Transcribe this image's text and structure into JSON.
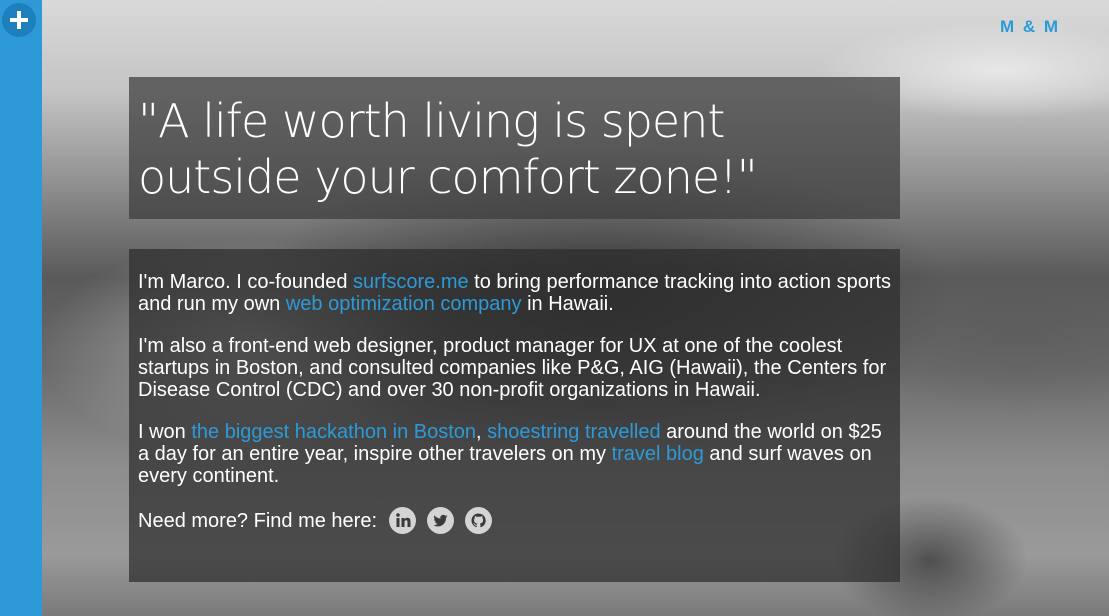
{
  "brand": {
    "label": "M & M"
  },
  "sidebar": {
    "toggle_icon": "plus-icon"
  },
  "hero": {
    "quote": "\"A life worth living is spent outside your comfort zone!\""
  },
  "bio": {
    "p1": {
      "t1": "I'm Marco. I co-founded ",
      "link1": "surfscore.me",
      "t2": " to bring performance tracking into action sports and run my own ",
      "link2": "web optimization company",
      "t3": " in Hawaii."
    },
    "p2": {
      "text": "I'm also a front-end web designer, product manager for UX at one of the coolest startups in Boston, and consulted companies like P&G, AIG (Hawaii), the Centers for Disease Control (CDC) and over 30 non-profit organizations in Hawaii."
    },
    "p3": {
      "t1": "I won ",
      "link1": "the biggest hackathon in Boston",
      "t2": ", ",
      "link2": "shoestring travelled",
      "t3": " around the world on $25 a day for an entire year, inspire other travelers on my ",
      "link3": "travel blog",
      "t4": " and surf waves on every continent."
    },
    "find_me": "Need more? Find me here:",
    "social": [
      "linkedin-icon",
      "twitter-icon",
      "github-icon"
    ]
  },
  "colors": {
    "accent": "#2d9ad7",
    "sidebar": "#2d9ad7"
  }
}
